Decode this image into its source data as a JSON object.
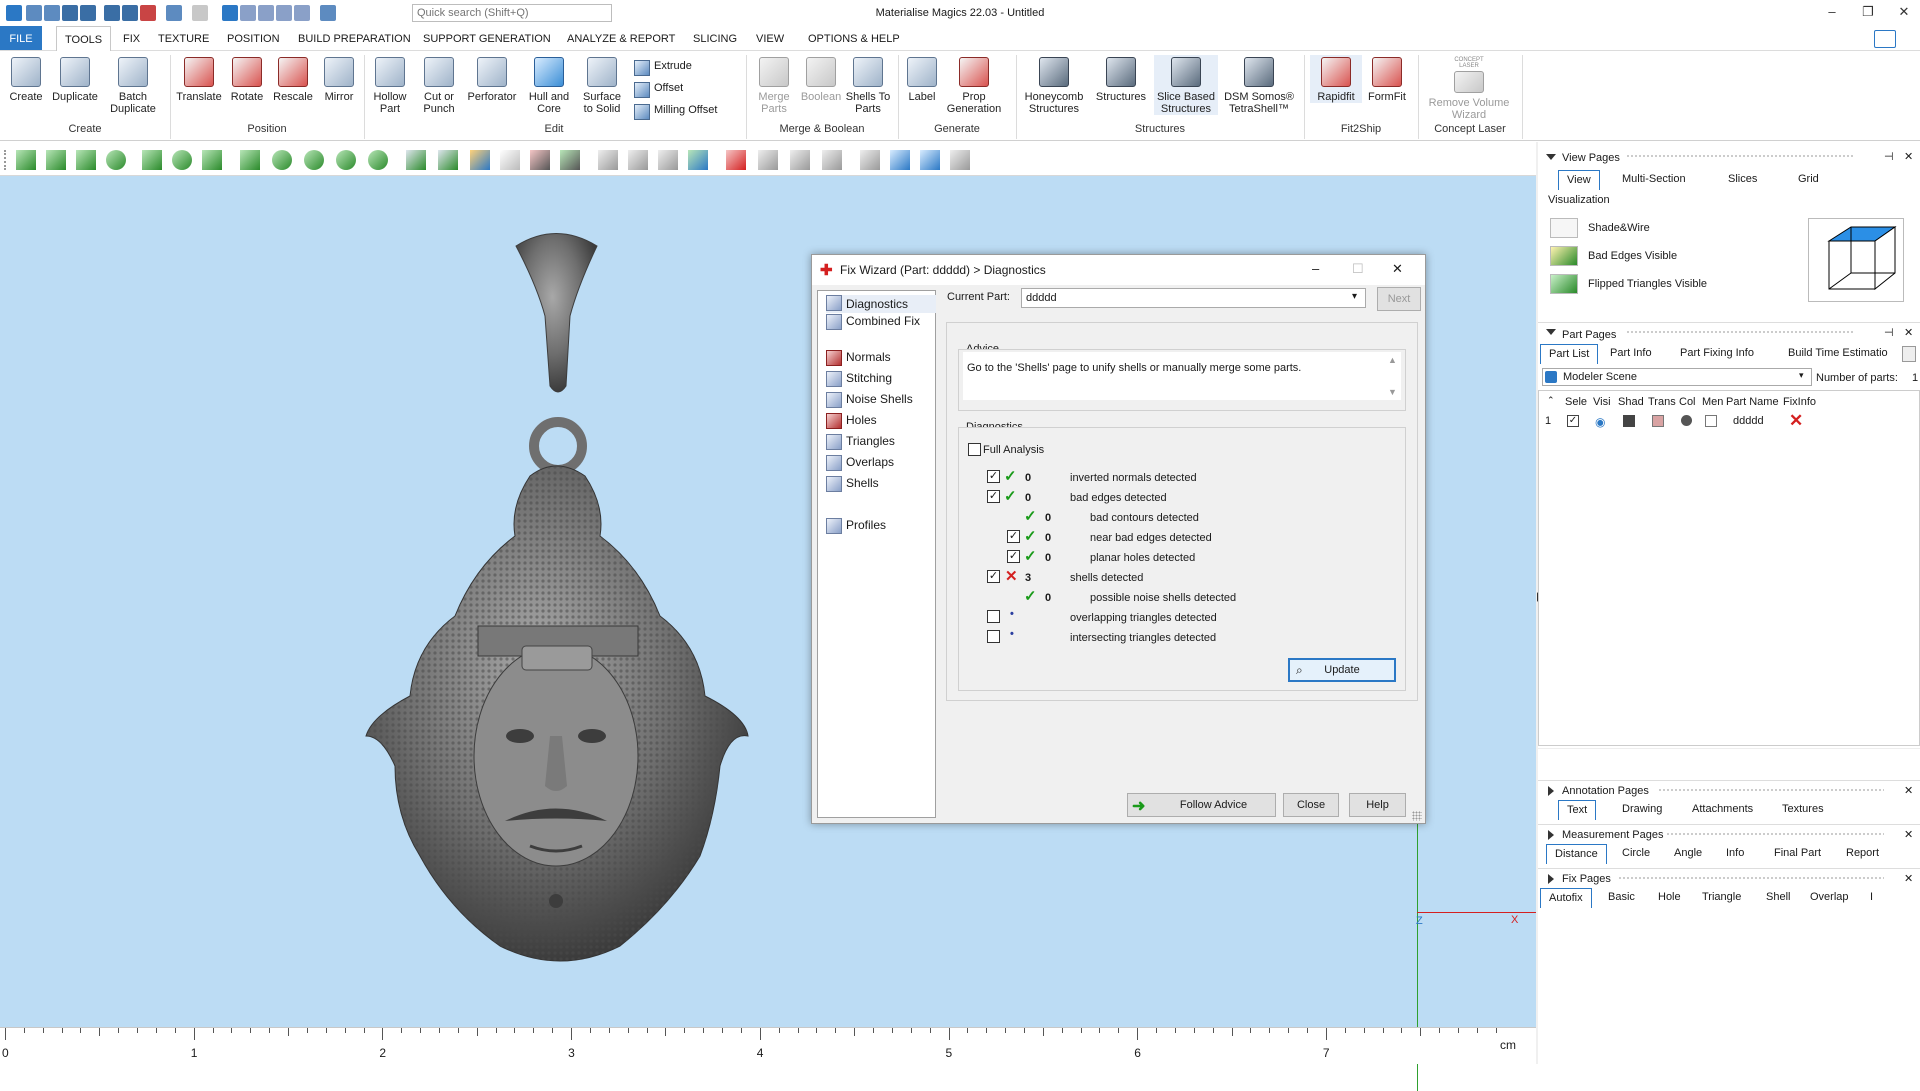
{
  "app": {
    "title": "Materialise Magics 22.03 - Untitled",
    "search_placeholder": "Quick search (Shift+Q)"
  },
  "menu": [
    "FILE",
    "TOOLS",
    "FIX",
    "TEXTURE",
    "POSITION",
    "BUILD PREPARATION",
    "SUPPORT GENERATION",
    "ANALYZE & REPORT",
    "SLICING",
    "VIEW",
    "OPTIONS & HELP"
  ],
  "ribbon": {
    "create": {
      "group": "Create",
      "items": [
        "Create",
        "Duplicate",
        "Batch Duplicate"
      ]
    },
    "position": {
      "group": "Position",
      "items": [
        "Translate",
        "Rotate",
        "Rescale",
        "Mirror"
      ]
    },
    "edit": {
      "group": "Edit",
      "items": [
        "Hollow Part",
        "Cut or Punch",
        "Perforator",
        "Hull and Core",
        "Surface to Solid"
      ],
      "small": [
        "Extrude",
        "Offset",
        "Milling Offset"
      ]
    },
    "merge": {
      "group": "Merge & Boolean",
      "items": [
        "Merge Parts",
        "Boolean",
        "Shells To Parts"
      ]
    },
    "generate": {
      "group": "Generate",
      "items": [
        "Label",
        "Prop Generation"
      ]
    },
    "structures": {
      "group": "Structures",
      "items": [
        "Honeycomb Structures",
        "Structures",
        "Slice Based Structures",
        "DSM Somos® TetraShell™"
      ]
    },
    "fit2ship": {
      "group": "Fit2Ship",
      "items": [
        "Rapidfit",
        "FormFit"
      ]
    },
    "concept": {
      "group": "Concept Laser",
      "items": [
        "Remove Volume Wizard"
      ],
      "badge": "CONCEPT LASER"
    }
  },
  "ruler": {
    "labels": [
      "0",
      "1",
      "2",
      "3",
      "4",
      "5",
      "6",
      "7"
    ],
    "unit": "cm"
  },
  "view_pages": {
    "title": "View Pages",
    "tabs": [
      "View",
      "Multi-Section",
      "Slices",
      "Grid"
    ],
    "section": "Visualization",
    "rows": [
      "Shade&Wire",
      "Bad Edges Visible",
      "Flipped Triangles Visible"
    ]
  },
  "part_pages": {
    "title": "Part Pages",
    "tabs": [
      "Part List",
      "Part Info",
      "Part Fixing Info",
      "Build Time Estimatio"
    ],
    "scene": "Modeler Scene",
    "count_label": "Number of parts:",
    "count": "1",
    "columns": [
      "Sele",
      "Visi",
      "Shad",
      "Trans",
      "Col",
      "Men",
      "Part Name",
      "FixInfo"
    ],
    "rows": [
      {
        "index": "1",
        "name": "ddddd"
      }
    ]
  },
  "annotation_pages": {
    "title": "Annotation Pages",
    "tabs": [
      "Text",
      "Drawing",
      "Attachments",
      "Textures"
    ]
  },
  "measurement_pages": {
    "title": "Measurement Pages",
    "tabs": [
      "Distance",
      "Circle",
      "Angle",
      "Info",
      "Final Part",
      "Report"
    ]
  },
  "fix_pages": {
    "title": "Fix Pages",
    "tabs": [
      "Autofix",
      "Basic",
      "Hole",
      "Triangle",
      "Shell",
      "Overlap",
      "I"
    ]
  },
  "dialog": {
    "title": "Fix Wizard (Part: ddddd) > Diagnostics",
    "nav": [
      "Diagnostics",
      "Combined Fix",
      "Normals",
      "Stitching",
      "Noise Shells",
      "Holes",
      "Triangles",
      "Overlaps",
      "Shells",
      "Profiles"
    ],
    "current_part_label": "Current Part:",
    "current_part": "ddddd",
    "next": "Next",
    "advice_label": "Advice",
    "advice_text": "Go to the 'Shells' page to unify shells or manually merge some parts.",
    "diagnostics_label": "Diagnostics",
    "full_analysis": "Full Analysis",
    "rows": [
      {
        "count": "0",
        "text": "inverted normals detected",
        "status": "ok"
      },
      {
        "count": "0",
        "text": "bad edges detected",
        "status": "ok"
      },
      {
        "count": "0",
        "text": "bad contours detected",
        "status": "ok"
      },
      {
        "count": "0",
        "text": "near bad edges detected",
        "status": "ok"
      },
      {
        "count": "0",
        "text": "planar holes detected",
        "status": "ok"
      },
      {
        "count": "3",
        "text": "shells detected",
        "status": "error"
      },
      {
        "count": "0",
        "text": "possible noise shells detected",
        "status": "ok"
      },
      {
        "count": "",
        "text": "overlapping triangles detected",
        "status": "none"
      },
      {
        "count": "",
        "text": "intersecting triangles detected",
        "status": "none"
      }
    ],
    "update": "Update",
    "follow": "Follow Advice",
    "close": "Close",
    "help": "Help"
  },
  "axis": {
    "z": "Z",
    "x": "X"
  },
  "colors": {
    "accent": "#2b78c5",
    "viewport": "#bcdcf4",
    "ok": "#1a9a1a",
    "error": "#d42020"
  }
}
